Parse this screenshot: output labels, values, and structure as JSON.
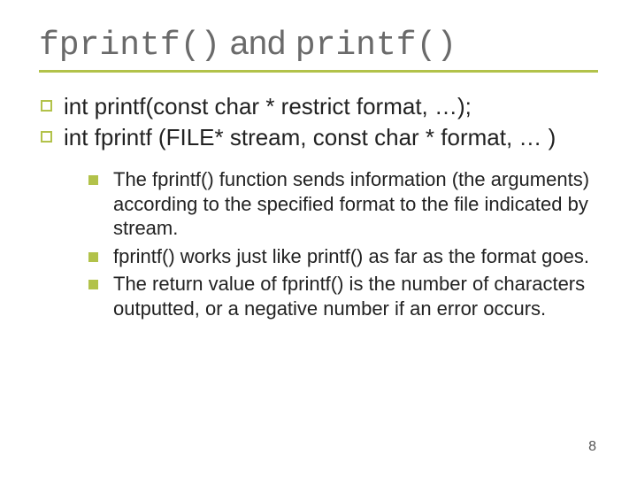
{
  "title": {
    "code1": "fprintf()",
    "mid": " and ",
    "code2": "printf()"
  },
  "bullets_top": [
    "int printf(const char * restrict format, …);",
    "int fprintf (FILE* stream, const char * format, … )"
  ],
  "bullets_sub": [
    "The fprintf() function sends information (the arguments) according to the specified format to the file indicated by stream.",
    "fprintf() works just like printf() as far as the format goes.",
    "The return value of fprintf() is the number of characters outputted, or a  negative number if an error occurs."
  ],
  "page_number": "8"
}
